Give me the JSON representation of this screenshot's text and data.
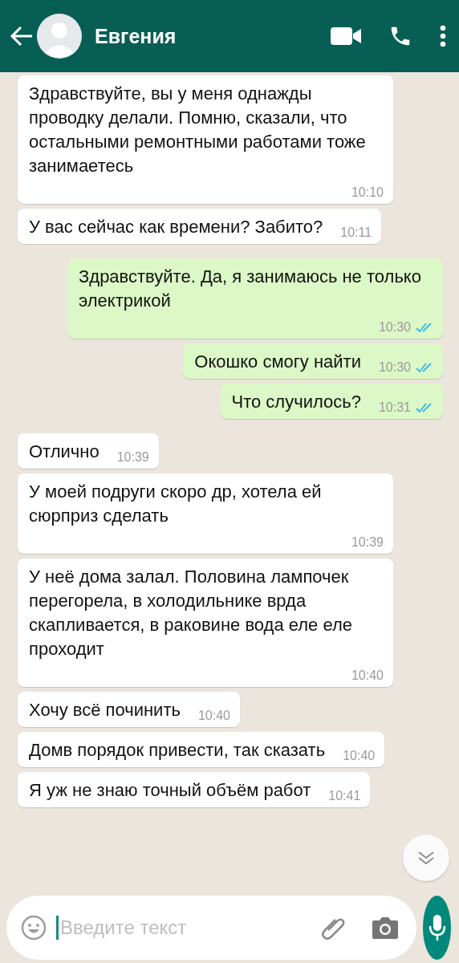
{
  "header": {
    "contact": "Евгения"
  },
  "messages": [
    {
      "kind": "incoming",
      "text": "Здравствуйте, вы у меня однажды проводку делали. Помню, сказали, что остальными ремонтными работами тоже занимаетесь",
      "time": "10:10"
    },
    {
      "kind": "incoming",
      "text": "У вас сейчас как времени? Забито?",
      "time": "10:11"
    },
    {
      "kind": "outgoing",
      "text": "Здравствуйте. Да, я занимаюсь не только электрикой",
      "time": "10:30",
      "read": true
    },
    {
      "kind": "outgoing",
      "text": "Окошко смогу найти",
      "time": "10:30",
      "read": true
    },
    {
      "kind": "outgoing",
      "text": "Что случилось?",
      "time": "10:31",
      "read": true
    },
    {
      "kind": "incoming",
      "text": "Отлично",
      "time": "10:39"
    },
    {
      "kind": "incoming",
      "text": "У моей подруги скоро др, хотела ей сюрприз сделать",
      "time": "10:39"
    },
    {
      "kind": "incoming",
      "text": "У неё дома залал. Половина лампочек перегорела, в холодильнике врда скапливается, в раковине вода еле еле проходит",
      "time": "10:40"
    },
    {
      "kind": "incoming",
      "text": "Хочу всё починить",
      "time": "10:40"
    },
    {
      "kind": "incoming",
      "text": "Домв порядок привести, так сказать",
      "time": "10:40"
    },
    {
      "kind": "incoming",
      "text": "Я уж не знаю точный объём работ",
      "time": "10:41"
    }
  ],
  "composer": {
    "placeholder": "Введите текст"
  }
}
